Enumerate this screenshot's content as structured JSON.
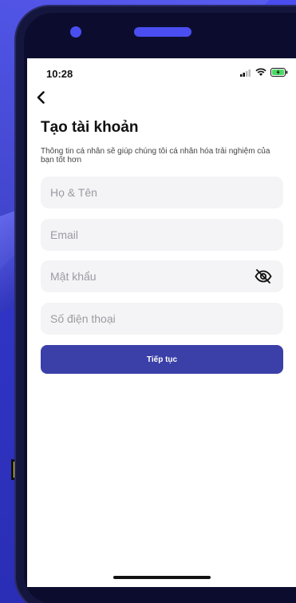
{
  "status": {
    "time": "10:28"
  },
  "header": {
    "title": "Tạo tài khoản",
    "subtitle": "Thông tin cá nhân sẽ giúp chúng tôi cá nhân hóa trải nghiệm của bạn tốt hơn"
  },
  "form": {
    "name_placeholder": "Họ & Tên",
    "email_placeholder": "Email",
    "password_placeholder": "Mật khẩu",
    "phone_placeholder": "Số điện thoại",
    "submit_label": "Tiếp tục"
  },
  "colors": {
    "primary": "#3b3fa8",
    "background": "#3b3fd8",
    "field_bg": "#f4f4f6"
  },
  "icons": {
    "back": "chevron-left-icon",
    "password_toggle": "eye-off-icon"
  }
}
